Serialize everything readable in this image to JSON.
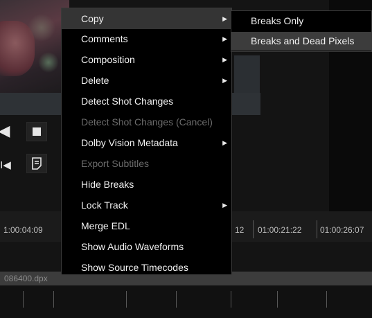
{
  "context_menu": {
    "items": [
      {
        "label": "Copy",
        "submenu": true,
        "highlighted": true,
        "disabled": false
      },
      {
        "label": "Comments",
        "submenu": true,
        "disabled": false
      },
      {
        "label": "Composition",
        "submenu": true,
        "disabled": false
      },
      {
        "label": "Delete",
        "submenu": true,
        "disabled": false
      },
      {
        "label": "Detect Shot Changes",
        "submenu": false,
        "disabled": false
      },
      {
        "label": "Detect Shot Changes (Cancel)",
        "submenu": false,
        "disabled": true
      },
      {
        "label": "Dolby Vision Metadata",
        "submenu": true,
        "disabled": false
      },
      {
        "label": "Export Subtitles",
        "submenu": false,
        "disabled": true
      },
      {
        "label": "Hide Breaks",
        "submenu": false,
        "disabled": false
      },
      {
        "label": "Lock Track",
        "submenu": true,
        "disabled": false
      },
      {
        "label": "Merge EDL",
        "submenu": false,
        "disabled": false
      },
      {
        "label": "Show Audio Waveforms",
        "submenu": false,
        "disabled": false
      },
      {
        "label": "Show Source Timecodes",
        "submenu": false,
        "disabled": false
      }
    ],
    "arrow_glyph": "▶"
  },
  "copy_submenu": {
    "items": [
      {
        "label": "Breaks Only",
        "highlighted": false
      },
      {
        "label": "Breaks and Dead Pixels",
        "highlighted": true
      }
    ]
  },
  "timeline": {
    "timecodes": [
      "1:00:04:09",
      "12",
      "01:00:21:22",
      "01:00:26:07"
    ],
    "clip_name": "086400.dpx"
  },
  "transport": {
    "back_icon": "◀",
    "prev_icon": "I◀"
  }
}
